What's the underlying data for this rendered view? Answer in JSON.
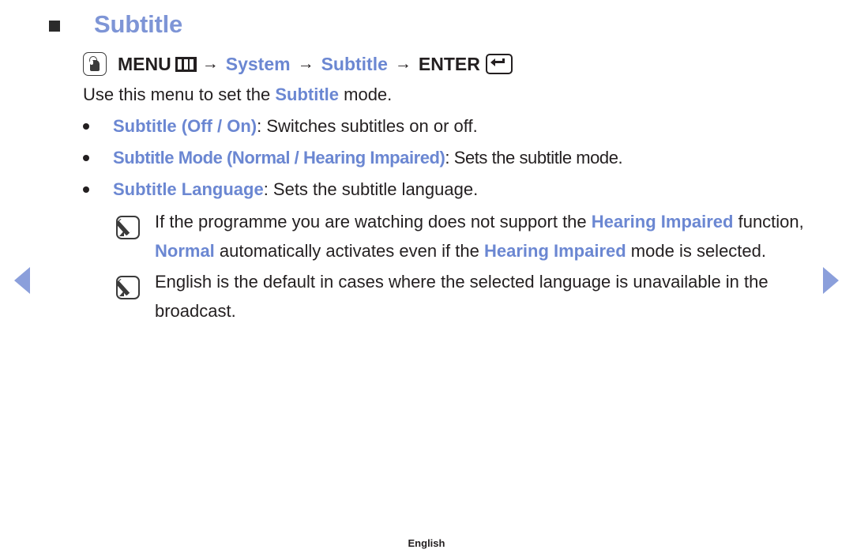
{
  "page": {
    "title": "Subtitle",
    "footer_label": "English",
    "accent_blue": "#6b87d2",
    "title_blue": "#7e95d6",
    "arrow_blue": "#8b9fdb",
    "text_dark": "#231f20"
  },
  "nav": {
    "prev_label": "Previous page",
    "next_label": "Next page"
  },
  "menu_path": {
    "touch_icon": "touch-hand-icon",
    "menu_label": "MENU",
    "menu_icon": "menu-grid-icon",
    "arrow_1": "→",
    "system_label": "System",
    "arrow_2": "→",
    "subtitle_label": "Subtitle",
    "arrow_3": "→",
    "enter_label": "ENTER",
    "enter_icon": "enter-key-icon"
  },
  "intro": {
    "before": "Use this menu to set the ",
    "highlight": "Subtitle",
    "after": " mode."
  },
  "bullets": [
    {
      "term": "Subtitle (Off / On)",
      "description": ": Switches subtitles on or off."
    },
    {
      "term": "Subtitle Mode (Normal / Hearing Impaired)",
      "description": ": Sets the subtitle mode."
    },
    {
      "term": "Subtitle Language",
      "description": ": Sets the subtitle language."
    }
  ],
  "notes": [
    {
      "icon": "note-pencil-icon",
      "parts": [
        {
          "text": "If the programme you are watching does not support the ",
          "style": "plain"
        },
        {
          "text": "Hearing Impaired",
          "style": "highlight"
        },
        {
          "text": " function, ",
          "style": "plain"
        },
        {
          "text": "Normal",
          "style": "highlight"
        },
        {
          "text": " automatically activates even if the ",
          "style": "plain"
        },
        {
          "text": "Hearing Impaired",
          "style": "highlight"
        },
        {
          "text": " mode is selected.",
          "style": "plain"
        }
      ]
    },
    {
      "icon": "note-pencil-icon",
      "parts": [
        {
          "text": "English is the default in cases where the selected language is unavailable in the broadcast.",
          "style": "plain"
        }
      ]
    }
  ]
}
